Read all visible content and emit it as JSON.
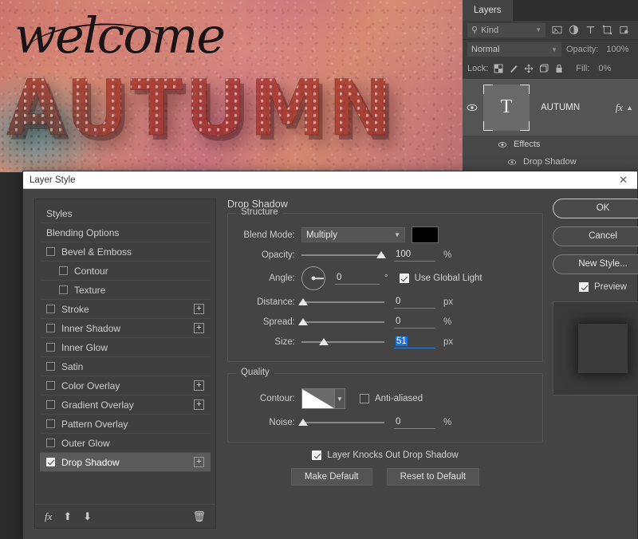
{
  "canvas": {
    "script_text": "welcome",
    "headline_text": "AUTUMN"
  },
  "layers_panel": {
    "tab_label": "Layers",
    "filter": {
      "kind_label": "Kind",
      "search_icon": "search-icon",
      "icons": [
        "image-filter-icon",
        "adjustment-filter-icon",
        "type-filter-icon",
        "shape-filter-icon",
        "smart-object-filter-icon"
      ]
    },
    "blend_mode": "Normal",
    "opacity_label": "Opacity:",
    "opacity_value": "100%",
    "lock_label": "Lock:",
    "lock_icons": [
      "lock-transparent-pixels-icon",
      "lock-image-pixels-icon",
      "lock-position-icon",
      "lock-artboard-icon",
      "lock-all-icon"
    ],
    "fill_label": "Fill:",
    "fill_value": "0%",
    "layer": {
      "name": "AUTUMN",
      "thumbnail_glyph": "T",
      "visibility_icon": "eye-icon",
      "fx_badge": "fx",
      "expand_caret": "chevron-up-icon"
    },
    "effects_row": "Effects",
    "effect_item": "Drop Shadow"
  },
  "dialog": {
    "title": "Layer Style",
    "close_label": "✕",
    "styles": {
      "items": [
        {
          "label": "Styles",
          "type": "header",
          "checked": false,
          "indent": false,
          "plus": false,
          "selected": false
        },
        {
          "label": "Blending Options",
          "type": "header",
          "checked": false,
          "indent": false,
          "plus": false,
          "selected": false
        },
        {
          "label": "Bevel & Emboss",
          "type": "effect",
          "checked": false,
          "indent": false,
          "plus": false,
          "selected": false
        },
        {
          "label": "Contour",
          "type": "effect",
          "checked": false,
          "indent": true,
          "plus": false,
          "selected": false
        },
        {
          "label": "Texture",
          "type": "effect",
          "checked": false,
          "indent": true,
          "plus": false,
          "selected": false
        },
        {
          "label": "Stroke",
          "type": "effect",
          "checked": false,
          "indent": false,
          "plus": true,
          "selected": false
        },
        {
          "label": "Inner Shadow",
          "type": "effect",
          "checked": false,
          "indent": false,
          "plus": true,
          "selected": false
        },
        {
          "label": "Inner Glow",
          "type": "effect",
          "checked": false,
          "indent": false,
          "plus": false,
          "selected": false
        },
        {
          "label": "Satin",
          "type": "effect",
          "checked": false,
          "indent": false,
          "plus": false,
          "selected": false
        },
        {
          "label": "Color Overlay",
          "type": "effect",
          "checked": false,
          "indent": false,
          "plus": true,
          "selected": false
        },
        {
          "label": "Gradient Overlay",
          "type": "effect",
          "checked": false,
          "indent": false,
          "plus": true,
          "selected": false
        },
        {
          "label": "Pattern Overlay",
          "type": "effect",
          "checked": false,
          "indent": false,
          "plus": false,
          "selected": false
        },
        {
          "label": "Outer Glow",
          "type": "effect",
          "checked": false,
          "indent": false,
          "plus": false,
          "selected": false
        },
        {
          "label": "Drop Shadow",
          "type": "effect",
          "checked": true,
          "indent": false,
          "plus": true,
          "selected": true
        }
      ],
      "footer_icons": [
        "fx-icon",
        "move-up-icon",
        "move-down-icon",
        "trash-icon"
      ],
      "fx_icon_label": "fx"
    },
    "panel": {
      "title": "Drop Shadow",
      "structure": {
        "legend": "Structure",
        "blend_mode_label": "Blend Mode:",
        "blend_mode_value": "Multiply",
        "shadow_color": "#000000",
        "opacity_label": "Opacity:",
        "opacity_value": "100",
        "opacity_unit": "%",
        "opacity_pct": 100,
        "angle_label": "Angle:",
        "angle_value": "0",
        "angle_unit": "°",
        "use_global_light_label": "Use Global Light",
        "use_global_light_checked": true,
        "distance_label": "Distance:",
        "distance_value": "0",
        "distance_unit": "px",
        "distance_pct": 0,
        "spread_label": "Spread:",
        "spread_value": "0",
        "spread_unit": "%",
        "spread_pct": 0,
        "size_label": "Size:",
        "size_value": "51",
        "size_unit": "px",
        "size_pct": 25,
        "size_selected": true
      },
      "quality": {
        "legend": "Quality",
        "contour_label": "Contour:",
        "contour_preset": "linear-contour",
        "anti_aliased_label": "Anti-aliased",
        "anti_aliased_checked": false,
        "noise_label": "Noise:",
        "noise_value": "0",
        "noise_unit": "%",
        "noise_pct": 0
      },
      "knockout_label": "Layer Knocks Out Drop Shadow",
      "knockout_checked": true,
      "make_default_label": "Make Default",
      "reset_default_label": "Reset to Default"
    },
    "buttons": {
      "ok": "OK",
      "cancel": "Cancel",
      "new_style": "New Style...",
      "preview_label": "Preview",
      "preview_checked": true
    }
  }
}
